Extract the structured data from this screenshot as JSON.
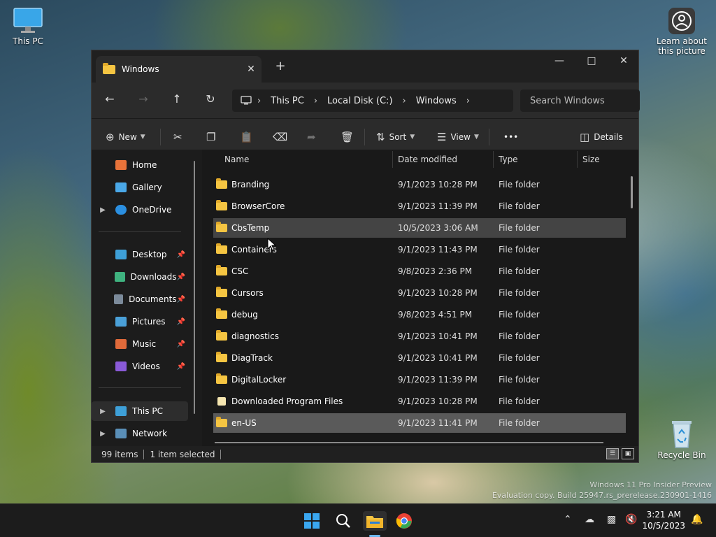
{
  "desktop": {
    "this_pc_label": "This PC",
    "learn_label_1": "Learn about",
    "learn_label_2": "this picture",
    "recycle_label": "Recycle Bin",
    "watermark_line1": "Windows 11 Pro Insider Preview",
    "watermark_line2": "Evaluation copy. Build 25947.rs_prerelease.230901-1416"
  },
  "window": {
    "tab_title": "Windows",
    "new_tab_glyph": "+",
    "address": {
      "crumbs": [
        "This PC",
        "Local Disk (C:)",
        "Windows"
      ]
    },
    "search_placeholder": "Search Windows",
    "cmdbar": {
      "new_label": "New",
      "sort_label": "Sort",
      "view_label": "View",
      "more_label": "•••",
      "details_label": "Details"
    },
    "sidebar": {
      "items": [
        {
          "label": "Home"
        },
        {
          "label": "Gallery"
        },
        {
          "label": "OneDrive"
        },
        {
          "label": "Desktop"
        },
        {
          "label": "Downloads"
        },
        {
          "label": "Documents"
        },
        {
          "label": "Pictures"
        },
        {
          "label": "Music"
        },
        {
          "label": "Videos"
        },
        {
          "label": "This PC"
        },
        {
          "label": "Network"
        }
      ]
    },
    "columns": [
      "Name",
      "Date modified",
      "Type",
      "Size"
    ],
    "rows": [
      {
        "name": "Branding",
        "date": "9/1/2023 10:28 PM",
        "type": "File folder"
      },
      {
        "name": "BrowserCore",
        "date": "9/1/2023 11:39 PM",
        "type": "File folder"
      },
      {
        "name": "CbsTemp",
        "date": "10/5/2023 3:06 AM",
        "type": "File folder"
      },
      {
        "name": "Containers",
        "date": "9/1/2023 11:43 PM",
        "type": "File folder"
      },
      {
        "name": "CSC",
        "date": "9/8/2023 2:36 PM",
        "type": "File folder"
      },
      {
        "name": "Cursors",
        "date": "9/1/2023 10:28 PM",
        "type": "File folder"
      },
      {
        "name": "debug",
        "date": "9/8/2023 4:51 PM",
        "type": "File folder"
      },
      {
        "name": "diagnostics",
        "date": "9/1/2023 10:41 PM",
        "type": "File folder"
      },
      {
        "name": "DiagTrack",
        "date": "9/1/2023 10:41 PM",
        "type": "File folder"
      },
      {
        "name": "DigitalLocker",
        "date": "9/1/2023 11:39 PM",
        "type": "File folder"
      },
      {
        "name": "Downloaded Program Files",
        "date": "9/1/2023 10:28 PM",
        "type": "File folder"
      },
      {
        "name": "en-US",
        "date": "9/1/2023 11:41 PM",
        "type": "File folder"
      }
    ],
    "status": {
      "items_count": "99 items",
      "selected": "1 item selected"
    }
  },
  "taskbar": {
    "time": "3:21 AM",
    "date": "10/5/2023"
  }
}
